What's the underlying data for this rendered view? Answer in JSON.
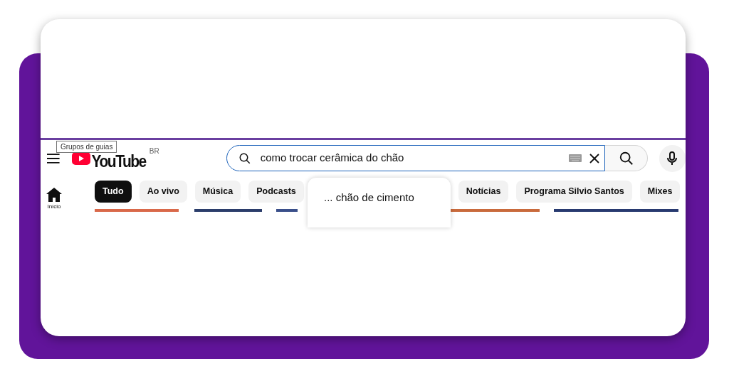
{
  "tooltip": "Grupos de guias",
  "logo": {
    "wordmark": "YouTube",
    "region": "BR"
  },
  "search": {
    "value": "como trocar cerâmica do chão",
    "focused": true
  },
  "suggestion": "... chão de cimento",
  "sidebar": [
    {
      "label": "Início",
      "selected": true
    }
  ],
  "chips": [
    {
      "label": "Tudo",
      "selected": true
    },
    {
      "label": "Ao vivo",
      "selected": false
    },
    {
      "label": "Música",
      "selected": false
    },
    {
      "label": "Podcasts",
      "selected": false
    },
    {
      "label": "Notícias",
      "selected": false
    },
    {
      "label": "Programa Silvio Santos",
      "selected": false
    },
    {
      "label": "Mixes",
      "selected": false
    }
  ]
}
